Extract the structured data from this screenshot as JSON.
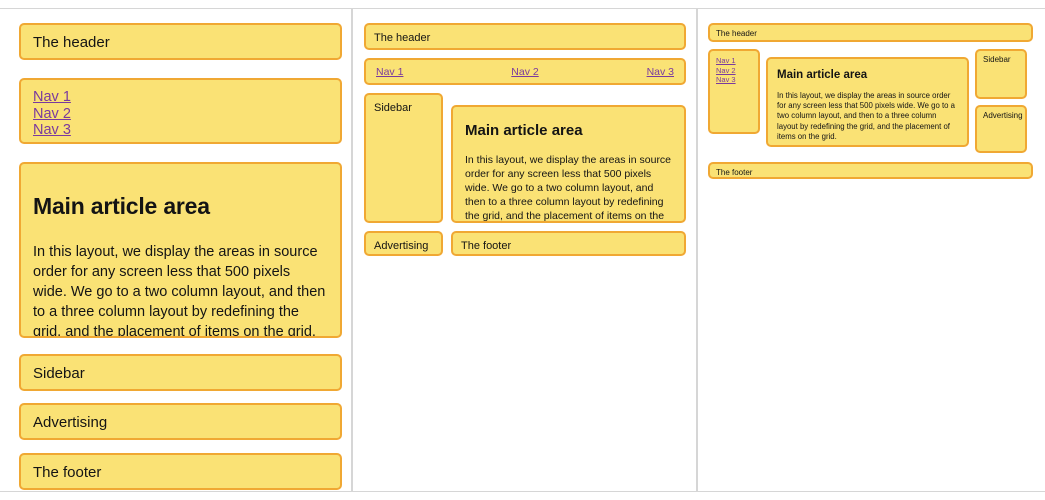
{
  "regions": {
    "header": "The header",
    "sidebar": "Sidebar",
    "advertising": "Advertising",
    "footer": "The footer",
    "main_heading": "Main article area",
    "main_body": "In this layout, we display the areas in source order for any screen less that 500 pixels wide. We go to a two column layout, and then to a three column layout by redefining the grid, and the placement of items on the grid."
  },
  "nav": {
    "item_1": "Nav 1",
    "item_2": "Nav 2",
    "item_3": "Nav 3"
  },
  "panels": [
    {
      "name": "single-column-layout"
    },
    {
      "name": "two-column-layout"
    },
    {
      "name": "three-column-layout"
    }
  ],
  "colors": {
    "box_fill": "#fae275",
    "box_border": "#f0a833",
    "link": "#7a3a9e",
    "text": "#141414",
    "panel_divider": "#d6d6d6",
    "page_background": "#ffffff"
  }
}
